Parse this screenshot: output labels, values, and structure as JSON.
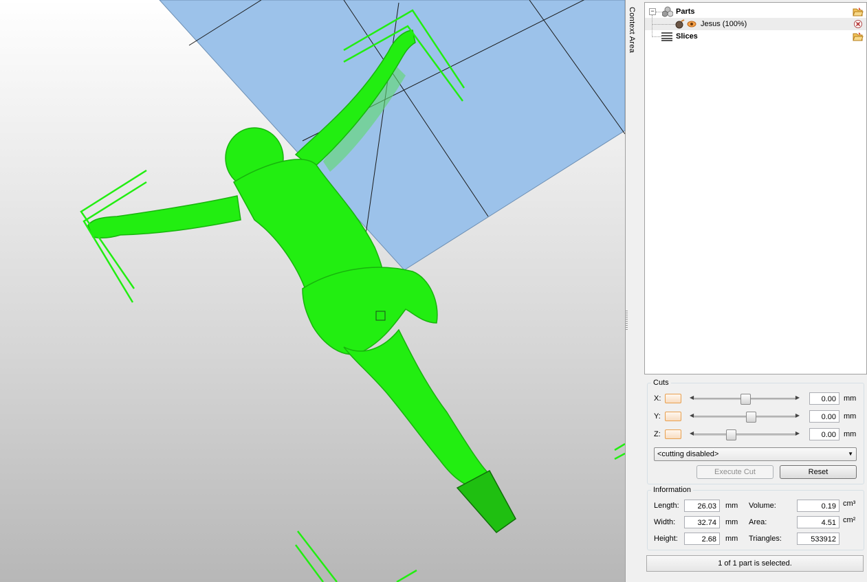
{
  "viewport": {
    "model_color": "#22ee11",
    "plate_color": "#9cc2ea"
  },
  "sidebar": {
    "context_label": "Context Area"
  },
  "tree": {
    "parts_label": "Parts",
    "part_item_label": "Jesus (100%)",
    "slices_label": "Slices",
    "expander_symbol": "−",
    "icons": {
      "parts": "parts-icon",
      "folder": "open-folder-icon",
      "part": "mesh-part-icon",
      "visibility": "eye-icon",
      "remove": "remove-icon",
      "slices": "slices-icon"
    }
  },
  "cuts": {
    "title": "Cuts",
    "axes": [
      {
        "label": "X:",
        "value": "0.00",
        "unit": "mm",
        "position": 0.5
      },
      {
        "label": "Y:",
        "value": "0.00",
        "unit": "mm",
        "position": 0.56
      },
      {
        "label": "Z:",
        "value": "0.00",
        "unit": "mm",
        "position": 0.35
      }
    ],
    "mode_select": "<cutting disabled>",
    "execute_label": "Execute Cut",
    "reset_label": "Reset"
  },
  "information": {
    "title": "Information",
    "length_label": "Length:",
    "length_value": "26.03",
    "length_unit": "mm",
    "width_label": "Width:",
    "width_value": "32.74",
    "width_unit": "mm",
    "height_label": "Height:",
    "height_value": "2.68",
    "height_unit": "mm",
    "volume_label": "Volume:",
    "volume_value": "0.19",
    "volume_unit": "cm³",
    "area_label": "Area:",
    "area_value": "4.51",
    "area_unit": "cm²",
    "triangles_label": "Triangles:",
    "triangles_value": "533912"
  },
  "status": {
    "text": "1 of 1 part is selected."
  }
}
